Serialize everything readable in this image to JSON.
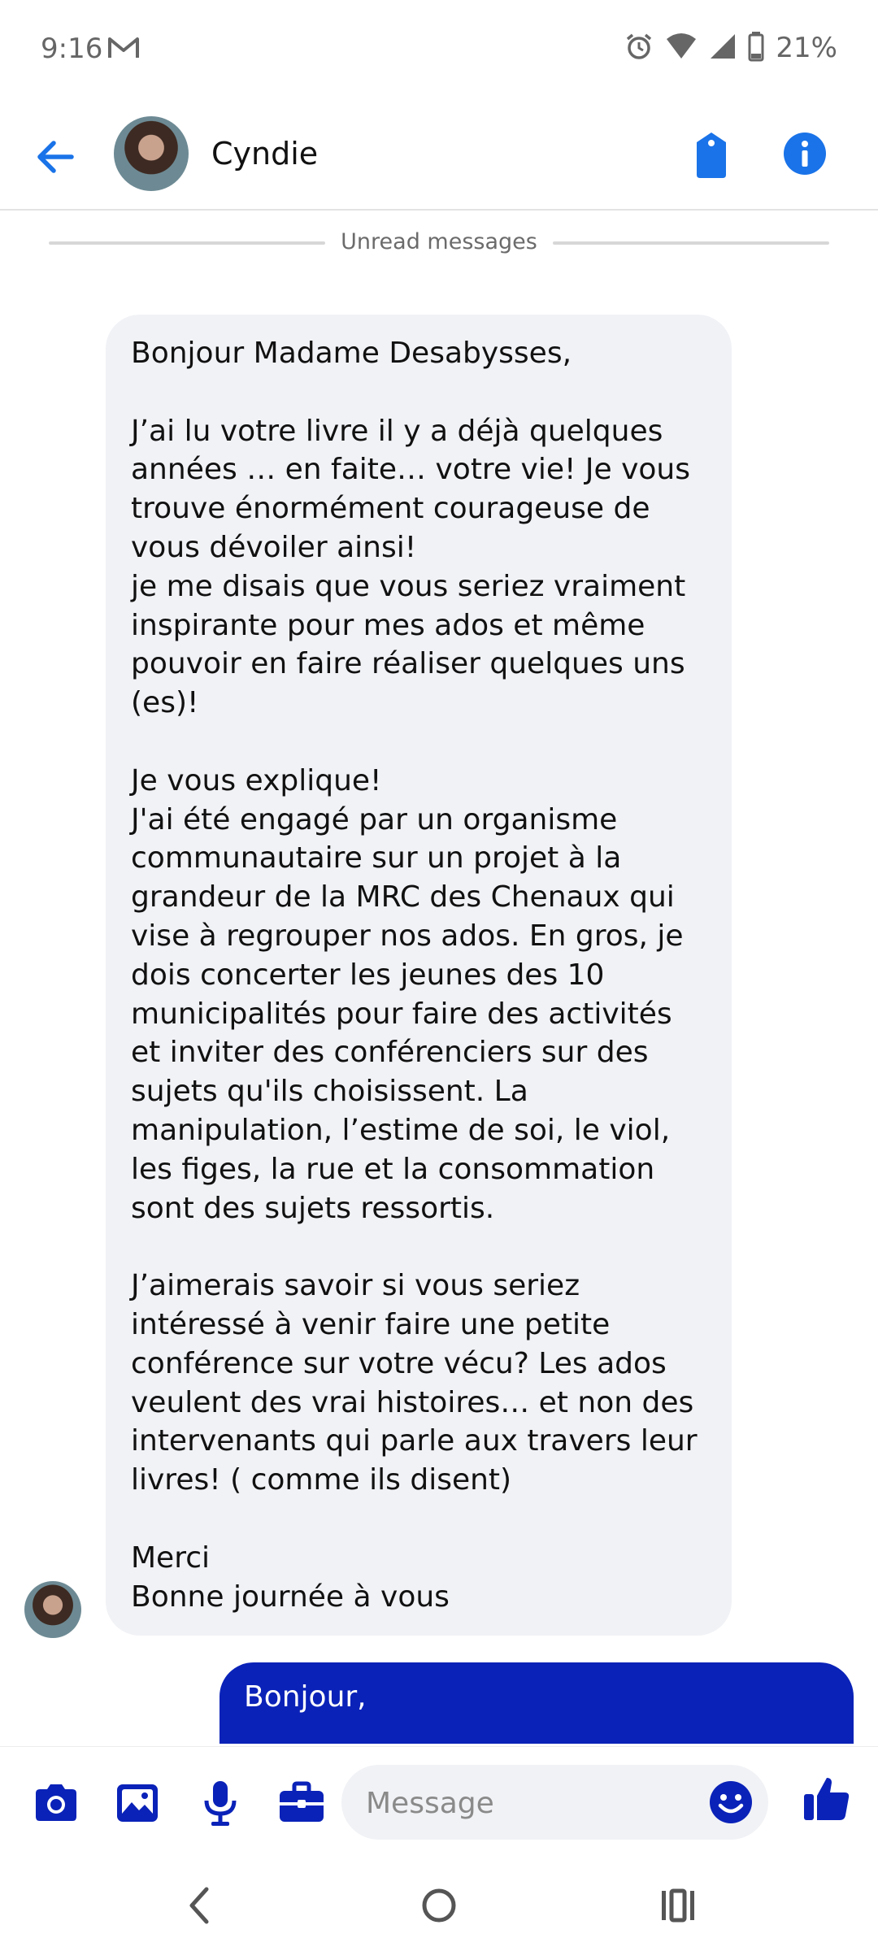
{
  "status_bar": {
    "time": "9:16",
    "battery_percent": "21%",
    "icons": [
      "gmail-icon",
      "alarm-icon",
      "wifi-icon",
      "signal-icon",
      "battery-icon"
    ]
  },
  "header": {
    "contact_name": "Cyndie",
    "icons": [
      "back-arrow-icon",
      "tag-icon",
      "info-icon"
    ]
  },
  "divider": {
    "label": "Unread messages"
  },
  "messages": [
    {
      "direction": "incoming",
      "text": "Bonjour Madame Desabysses,\n\nJ’ai lu votre livre il y a déjà quelques\nannées … en faite… votre vie! Je vous\ntrouve énormément courageuse de\nvous dévoiler ainsi!\nje me disais que vous seriez vraiment\ninspirante pour mes ados et même\npouvoir en faire réaliser quelques uns\n(es)!\n\nJe vous explique!\nJ'ai été engagé par un organisme\ncommunautaire sur un  projet à la\ngrandeur de la MRC des Chenaux qui\nvise à regrouper nos ados. En gros, je\ndois concerter les jeunes des 10\nmunicipalités pour faire des activités\net inviter des conférenciers sur des\nsujets qu'ils choisissent. La\nmanipulation, l’estime de soi, le viol,\nles figes, la rue et la consommation\nsont des sujets  ressortis.\n\nJ’aimerais savoir si vous seriez\nintéressé à venir faire une petite\nconférence sur votre vécu? Les ados\nveulent des vrai histoires… et non des\nintervenants qui parle aux travers leur\nlivres! ( comme ils disent)\n\nMerci\nBonne journée à vous"
    },
    {
      "direction": "outgoing",
      "text": "Bonjour,"
    }
  ],
  "composer": {
    "placeholder": "Message",
    "icons": [
      "camera-icon",
      "gallery-icon",
      "microphone-icon",
      "briefcase-icon",
      "emoji-icon",
      "thumbs-up-icon"
    ]
  },
  "colors": {
    "accent_blue": "#1a73e8",
    "outgoing_bubble": "#0a22b8",
    "incoming_bubble": "#f1f2f6",
    "composer_icon": "#0a22b8"
  }
}
